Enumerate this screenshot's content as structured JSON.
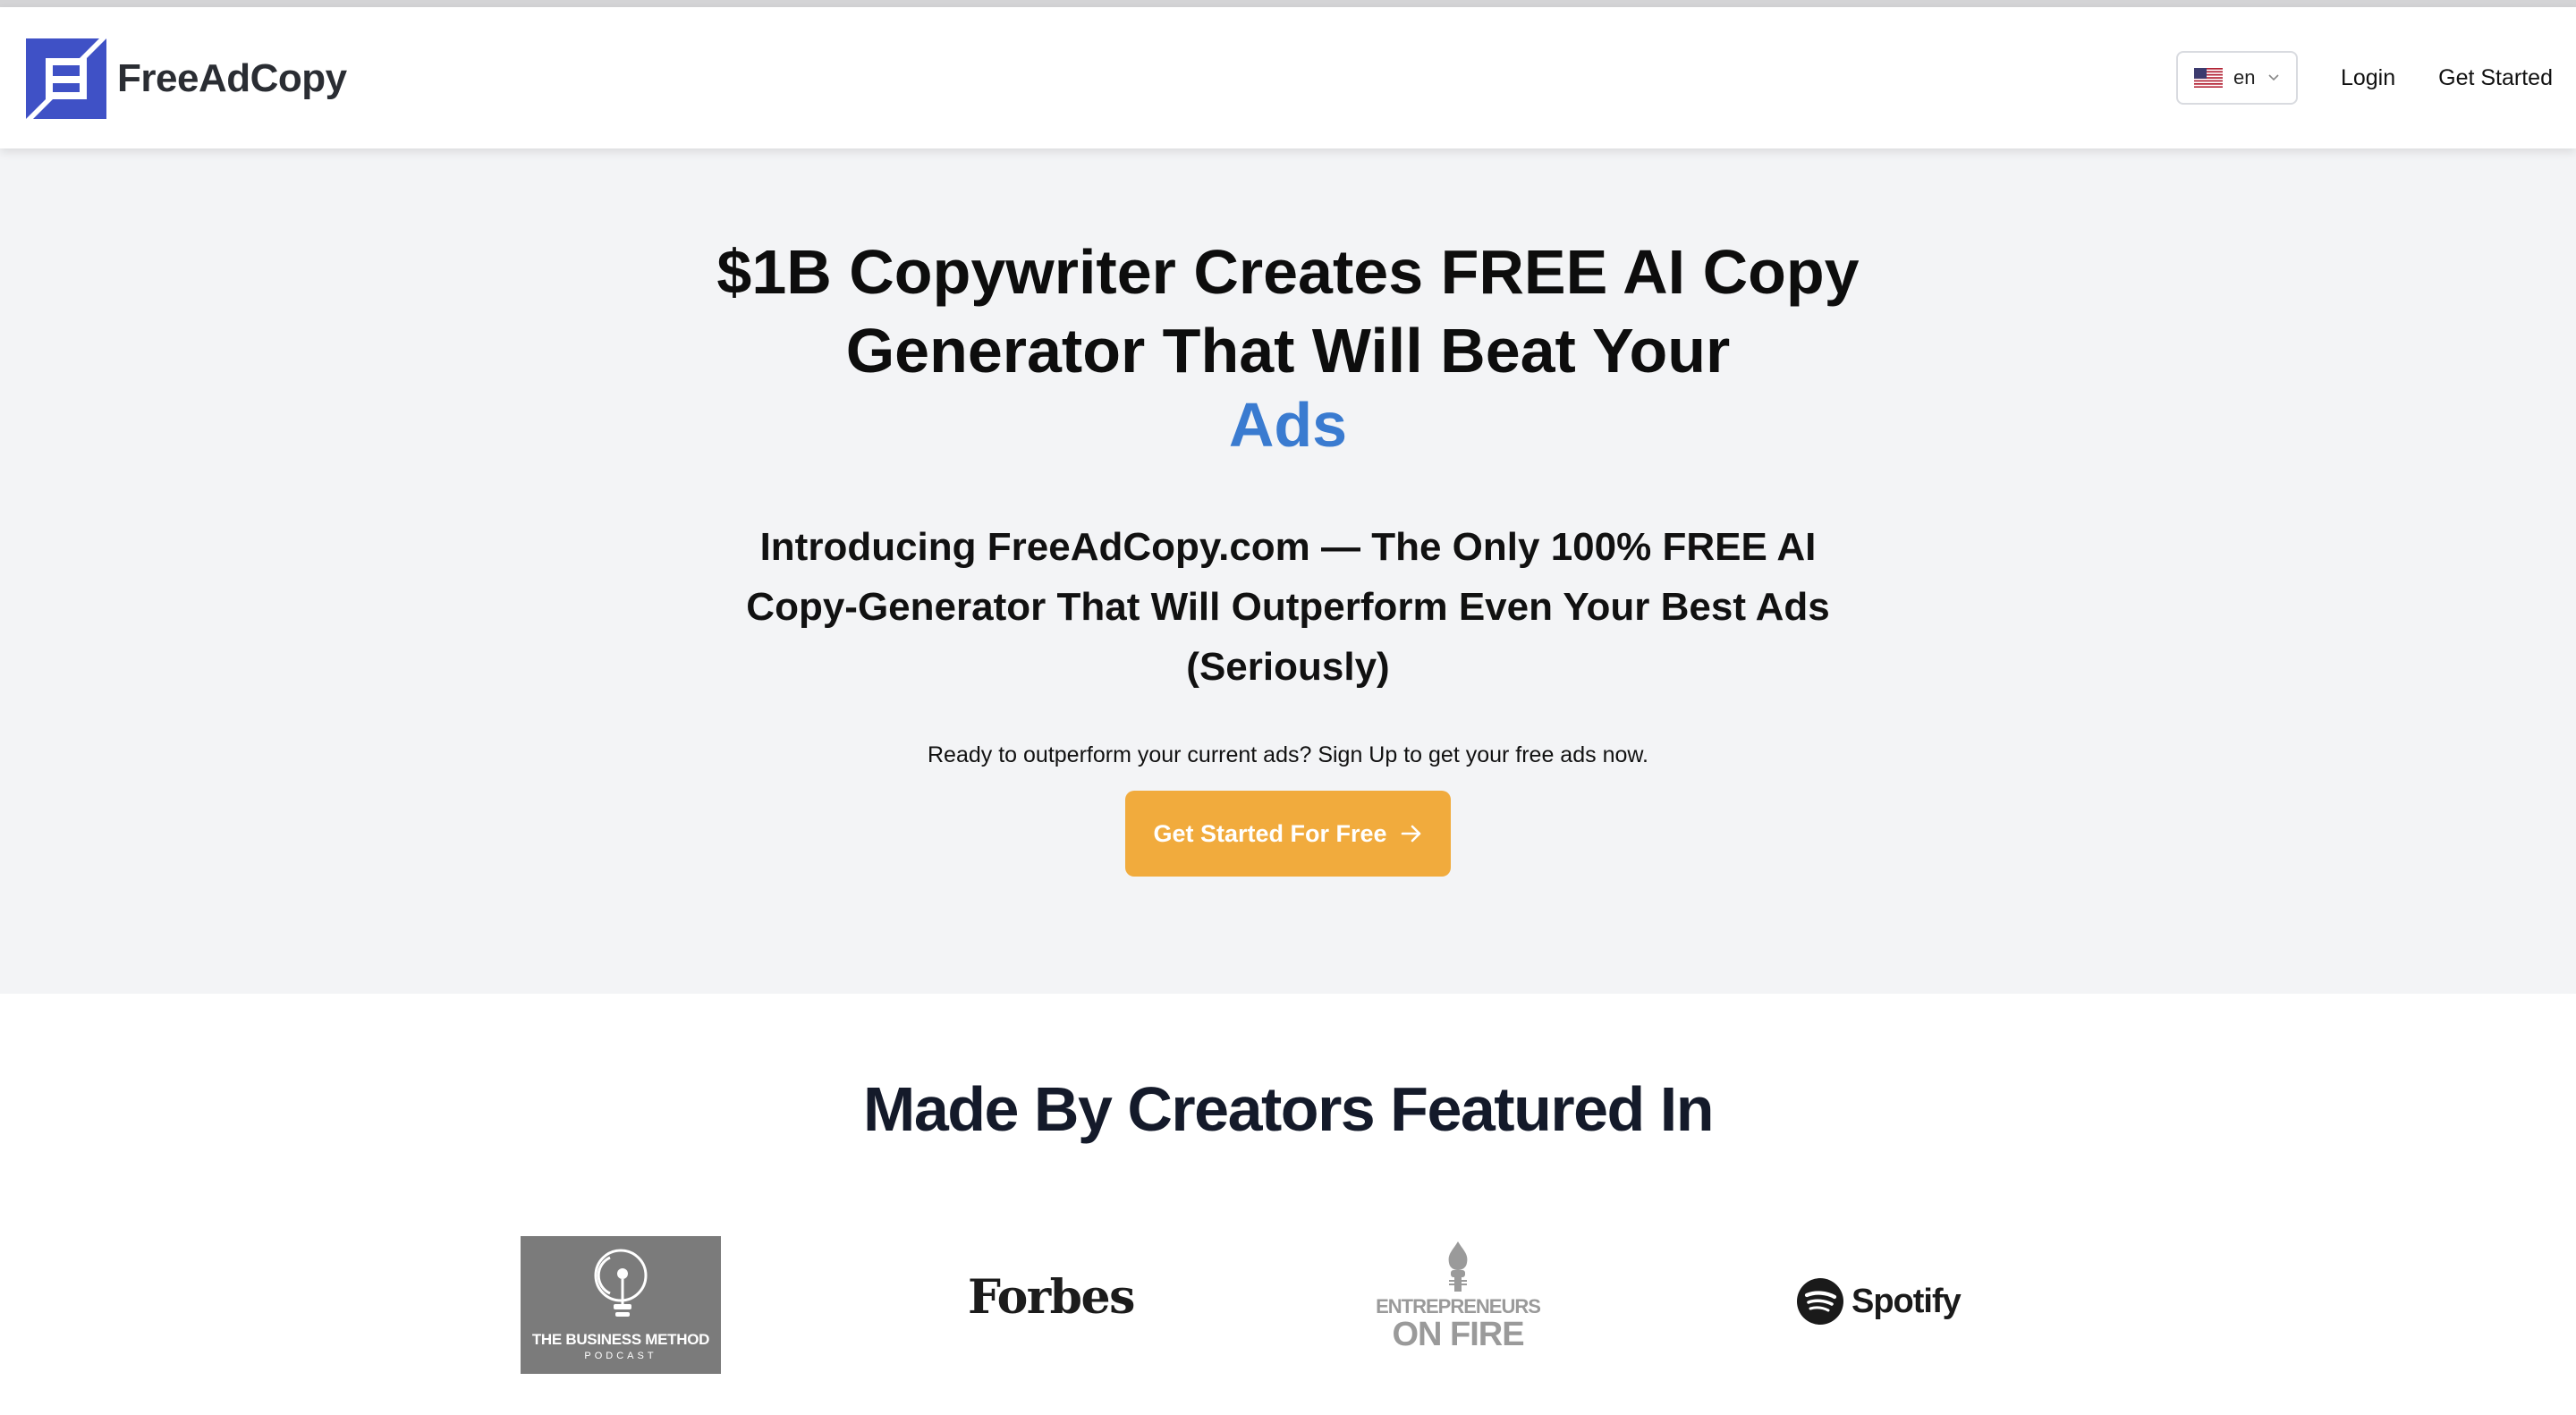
{
  "header": {
    "brand": "FreeAdCopy",
    "language": {
      "selected": "en"
    },
    "nav": {
      "login": "Login",
      "get_started": "Get Started"
    }
  },
  "hero": {
    "title_main": "$1B Copywriter Creates FREE AI Copy Generator That Will Beat Your",
    "title_accent": "Ads",
    "subtitle": "Introducing FreeAdCopy.com — The Only 100% FREE AI Copy-Generator That Will Outperform Even Your Best Ads (Seriously)",
    "prompt": "Ready to outperform your current ads? Sign Up to get your free ads now.",
    "cta_label": "Get Started For Free"
  },
  "featured": {
    "title": "Made By Creators Featured In",
    "logos": [
      {
        "icon": "business-method-podcast-logo",
        "line1": "THE BUSINESS METHOD",
        "line2": "PODCAST"
      },
      {
        "icon": "forbes-logo",
        "text": "Forbes"
      },
      {
        "icon": "entrepreneurs-on-fire-logo",
        "line1": "ENTREPRENEURS",
        "line2": "ON FIRE"
      },
      {
        "icon": "spotify-logo",
        "text": "Spotify"
      }
    ]
  },
  "colors": {
    "brand_blue": "#3f51c6",
    "accent_blue": "#3a7bd0",
    "cta_orange": "#f1ab3d",
    "hero_background": "#f3f4f6"
  }
}
